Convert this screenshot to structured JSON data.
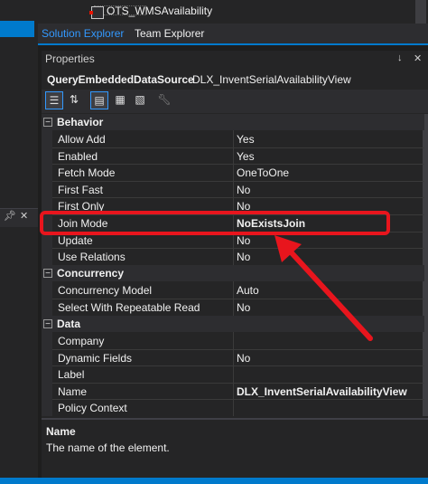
{
  "tree": {
    "item_label": "OTS_WMSAvailability",
    "icon": "dataset-icon"
  },
  "tabs": [
    {
      "label": "Solution Explorer",
      "active": true
    },
    {
      "label": "Team Explorer",
      "active": false
    }
  ],
  "properties": {
    "title": "Properties",
    "pin_icon": "pin-icon",
    "close_icon": "close-icon",
    "object_name": "QueryEmbeddedDataSource",
    "object_type": "DLX_InventSerialAvailabilityView",
    "toolbar": [
      "categorized-icon",
      "alphabetical-icon",
      "properties-icon",
      "events-icon",
      "property-pages-icon",
      "wrench-icon"
    ],
    "categories": [
      {
        "label": "Behavior",
        "rows": [
          {
            "name": "Allow Add",
            "value": "Yes"
          },
          {
            "name": "Enabled",
            "value": "Yes"
          },
          {
            "name": "Fetch Mode",
            "value": "OneToOne"
          },
          {
            "name": "First Fast",
            "value": "No"
          },
          {
            "name": "First Only",
            "value": "No"
          },
          {
            "name": "Join Mode",
            "value": "NoExistsJoin"
          },
          {
            "name": "Update",
            "value": "No"
          },
          {
            "name": "Use Relations",
            "value": "No"
          }
        ]
      },
      {
        "label": "Concurrency",
        "rows": [
          {
            "name": "Concurrency Model",
            "value": "Auto"
          },
          {
            "name": "Select With Repeatable Read",
            "value": "No"
          }
        ]
      },
      {
        "label": "Data",
        "rows": [
          {
            "name": "Company",
            "value": ""
          },
          {
            "name": "Dynamic Fields",
            "value": "No"
          },
          {
            "name": "Label",
            "value": ""
          },
          {
            "name": "Name",
            "value": "DLX_InventSerialAvailabilityView"
          },
          {
            "name": "Policy Context",
            "value": ""
          }
        ]
      }
    ],
    "description": {
      "title": "Name",
      "text": "The name of the element."
    }
  },
  "colors": {
    "accent": "#007acc",
    "highlight": "#e8151d",
    "background": "#252526"
  }
}
